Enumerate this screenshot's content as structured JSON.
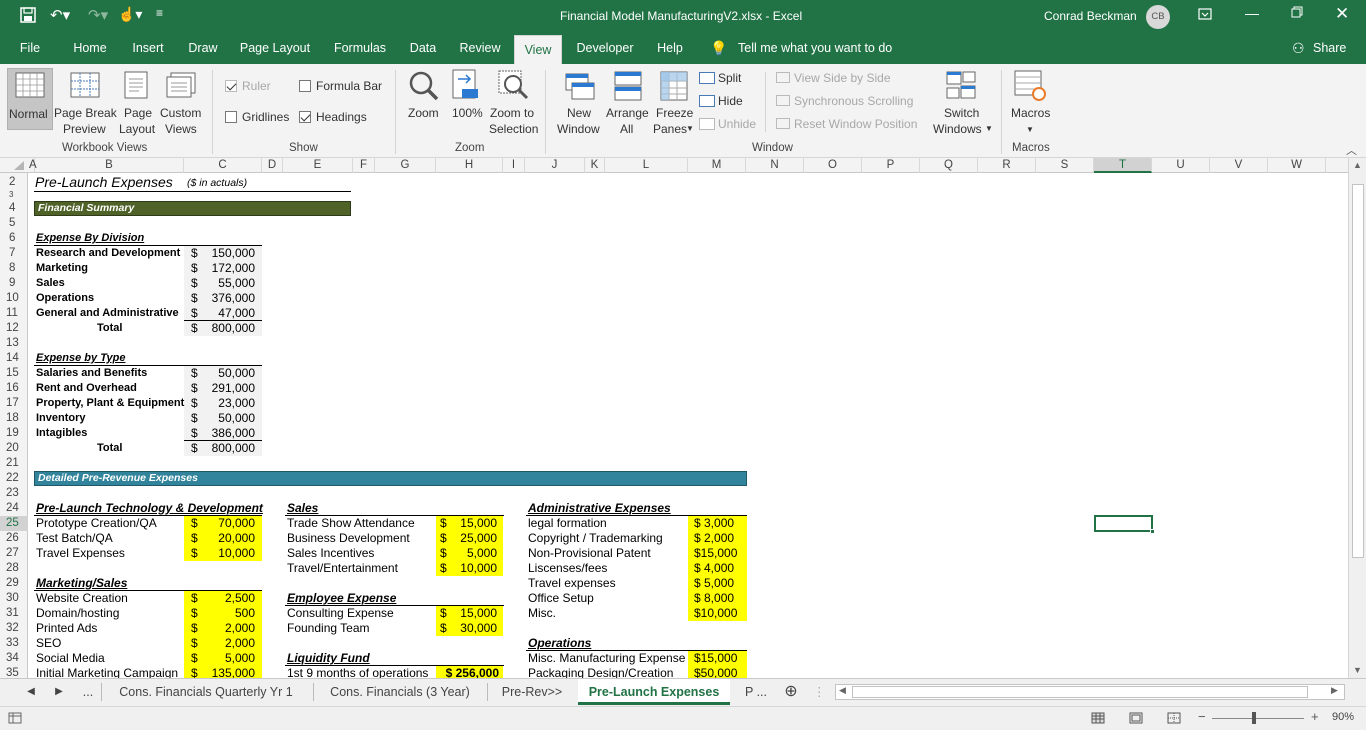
{
  "window": {
    "title": "Financial Model ManufacturingV2.xlsx  -  Excel",
    "user_name": "Conrad Beckman",
    "user_initials": "CB"
  },
  "ribbon_tabs": [
    "File",
    "Home",
    "Insert",
    "Draw",
    "Page Layout",
    "Formulas",
    "Data",
    "Review",
    "View",
    "Developer",
    "Help"
  ],
  "tell_me": "Tell me what you want to do",
  "share_label": "Share",
  "ribbon": {
    "normal": "Normal",
    "page_break_1": "Page Break",
    "page_break_2": "Preview",
    "page_layout_1": "Page",
    "page_layout_2": "Layout",
    "custom_views_1": "Custom",
    "custom_views_2": "Views",
    "workbook_views": "Workbook Views",
    "ruler": "Ruler",
    "formula_bar": "Formula Bar",
    "gridlines": "Gridlines",
    "headings": "Headings",
    "show": "Show",
    "zoom": "Zoom",
    "zoom100": "100%",
    "zoom_sel_1": "Zoom to",
    "zoom_sel_2": "Selection",
    "zoom_group": "Zoom",
    "new_window_1": "New",
    "new_window_2": "Window",
    "arrange_1": "Arrange",
    "arrange_2": "All",
    "freeze_1": "Freeze",
    "freeze_2": "Panes",
    "split": "Split",
    "hide": "Hide",
    "unhide": "Unhide",
    "view_side": "View Side by Side",
    "sync_scroll": "Synchronous Scrolling",
    "reset_pos": "Reset Window Position",
    "switch_1": "Switch",
    "switch_2": "Windows",
    "window_group": "Window",
    "macros": "Macros",
    "macros_group": "Macros"
  },
  "columns": [
    "A",
    "B",
    "C",
    "D",
    "E",
    "F",
    "G",
    "H",
    "I",
    "J",
    "K",
    "L",
    "M",
    "N",
    "O",
    "P",
    "Q",
    "R",
    "S",
    "T",
    "U",
    "V",
    "W"
  ],
  "rows": [
    "2",
    "3",
    "4",
    "5",
    "6",
    "7",
    "8",
    "9",
    "10",
    "11",
    "12",
    "13",
    "14",
    "15",
    "16",
    "17",
    "18",
    "19",
    "20",
    "21",
    "22",
    "23",
    "24",
    "25",
    "26",
    "27",
    "28",
    "29",
    "30",
    "31",
    "32",
    "33",
    "34",
    "35"
  ],
  "sheet": {
    "title": "Pre-Launch Expenses",
    "title_note": "($ in actuals)",
    "fin_summary": "Financial Summary",
    "div_head": "Expense By Division",
    "div_items": [
      {
        "label": "Research and Development",
        "cur": "$",
        "val": "150,000"
      },
      {
        "label": "Marketing",
        "cur": "$",
        "val": "172,000"
      },
      {
        "label": "Sales",
        "cur": "$",
        "val": "55,000"
      },
      {
        "label": "Operations",
        "cur": "$",
        "val": "376,000"
      },
      {
        "label": "General and Administrative",
        "cur": "$",
        "val": "47,000"
      }
    ],
    "div_total": {
      "label": "Total",
      "cur": "$",
      "val": "800,000"
    },
    "type_head": "Expense by Type",
    "type_items": [
      {
        "label": "Salaries and Benefits",
        "cur": "$",
        "val": "50,000"
      },
      {
        "label": "Rent and Overhead",
        "cur": "$",
        "val": "291,000"
      },
      {
        "label": "Property, Plant & Equipment",
        "cur": "$",
        "val": "23,000"
      },
      {
        "label": "Inventory",
        "cur": "$",
        "val": "50,000"
      },
      {
        "label": "Intagibles",
        "cur": "$",
        "val": "386,000"
      }
    ],
    "type_total": {
      "label": "Total",
      "cur": "$",
      "val": "800,000"
    },
    "detailed": "Detailed Pre-Revenue Expenses",
    "tech_head": "Pre-Launch Technology & Development",
    "tech_items": [
      {
        "label": "Prototype Creation/QA",
        "cur": "$",
        "val": "70,000"
      },
      {
        "label": "Test Batch/QA",
        "cur": "$",
        "val": "20,000"
      },
      {
        "label": "Travel Expenses",
        "cur": "$",
        "val": "10,000"
      }
    ],
    "mkt_head": "Marketing/Sales",
    "mkt_items": [
      {
        "label": "Website Creation",
        "cur": "$",
        "val": "2,500"
      },
      {
        "label": "Domain/hosting",
        "cur": "$",
        "val": "500"
      },
      {
        "label": "Printed Ads",
        "cur": "$",
        "val": "2,000"
      },
      {
        "label": "SEO",
        "cur": "$",
        "val": "2,000"
      },
      {
        "label": "Social Media",
        "cur": "$",
        "val": "5,000"
      },
      {
        "label": "Initial Marketing Campaign",
        "cur": "$",
        "val": "135,000"
      }
    ],
    "sales_head": "Sales",
    "sales_items": [
      {
        "label": "Trade Show Attendance",
        "cur": "$",
        "val": "15,000"
      },
      {
        "label": "Business Development",
        "cur": "$",
        "val": "25,000"
      },
      {
        "label": "Sales Incentives",
        "cur": "$",
        "val": "5,000"
      },
      {
        "label": "Travel/Entertainment",
        "cur": "$",
        "val": "10,000"
      }
    ],
    "emp_head": "Employee Expense",
    "emp_items": [
      {
        "label": "Consulting Expense",
        "cur": "$",
        "val": "15,000"
      },
      {
        "label": "Founding Team",
        "cur": "$",
        "val": "30,000"
      }
    ],
    "liq_head": "Liquidity Fund",
    "liq_item": {
      "label": "1st 9 months of operations",
      "val": "$ 256,000"
    },
    "admin_head": "Administrative Expenses",
    "admin_items": [
      {
        "label": "legal formation",
        "val": "$ 3,000"
      },
      {
        "label": "Copyright / Trademarking",
        "val": "$ 2,000"
      },
      {
        "label": "Non-Provisional Patent",
        "val": "$15,000"
      },
      {
        "label": "Liscenses/fees",
        "val": "$ 4,000"
      },
      {
        "label": "Travel expenses",
        "val": "$ 5,000"
      },
      {
        "label": "Office Setup",
        "val": "$ 8,000"
      },
      {
        "label": "Misc.",
        "val": "$10,000"
      }
    ],
    "ops_head": "Operations",
    "ops_items": [
      {
        "label": "Misc. Manufacturing Expense",
        "val": "$15,000"
      },
      {
        "label": "Packaging Design/Creation",
        "val": "$50,000"
      }
    ]
  },
  "sheet_tabs": [
    "Cons. Financials Quarterly Yr 1",
    "Cons. Financials (3 Year)",
    "Pre-Rev>>",
    "Pre-Launch Expenses",
    "P ..."
  ],
  "zoom_level": "90%",
  "colors": {
    "excel_green": "#217346",
    "summary_bar": "#4f6228",
    "detail_bar": "#31849b",
    "highlight": "#ffff00"
  }
}
